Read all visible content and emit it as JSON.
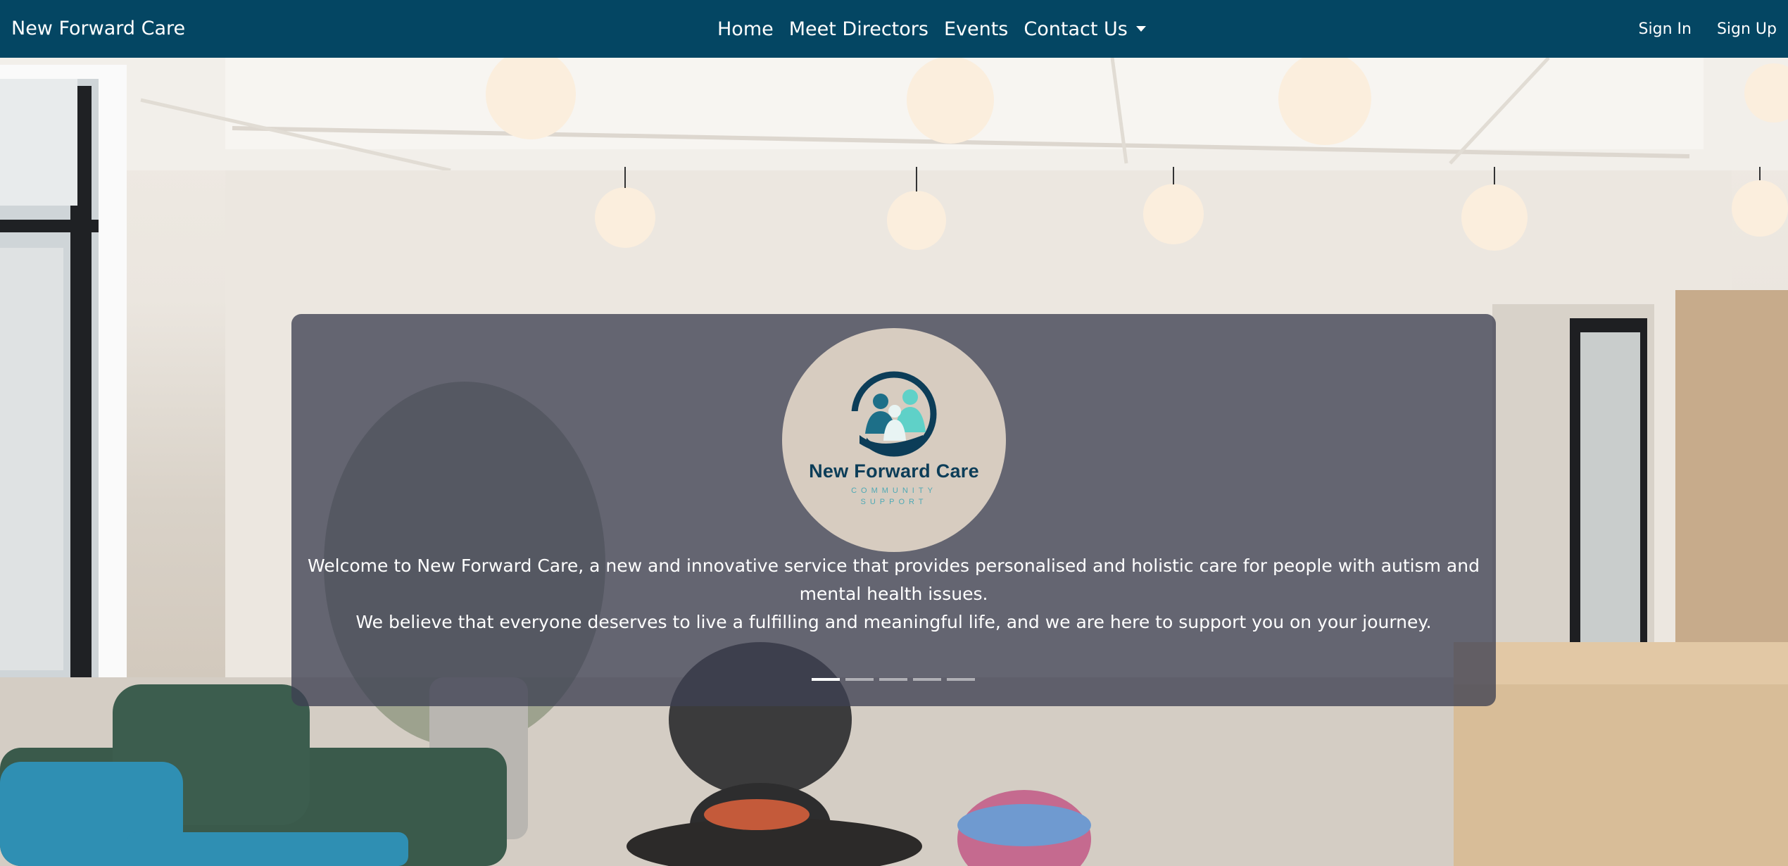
{
  "navbar": {
    "brand": "New Forward Care",
    "links": [
      {
        "label": "Home"
      },
      {
        "label": "Meet Directors"
      },
      {
        "label": "Events"
      },
      {
        "label": "Contact Us"
      }
    ],
    "auth": {
      "sign_in": "Sign In",
      "sign_up": "Sign Up"
    }
  },
  "carousel": {
    "logo": {
      "title": "New Forward Care",
      "subtitle_line1": "COMMUNITY",
      "subtitle_line2": "SUPPORT"
    },
    "caption_line1": "Welcome to New Forward Care, a new and innovative service that provides personalised and holistic care for people with autism and mental health issues.",
    "caption_line2": "We believe that everyone deserves to live a fulfilling and meaningful life, and we are here to support you on your journey.",
    "slide_count": 5,
    "active_slide": 1
  },
  "colors": {
    "navbar_bg": "#044663",
    "panel_bg": "rgba(62,64,82,0.78)",
    "logo_bg": "#d7ccc0",
    "logo_text": "#0c3d58",
    "logo_accent": "#4fa9b5"
  }
}
